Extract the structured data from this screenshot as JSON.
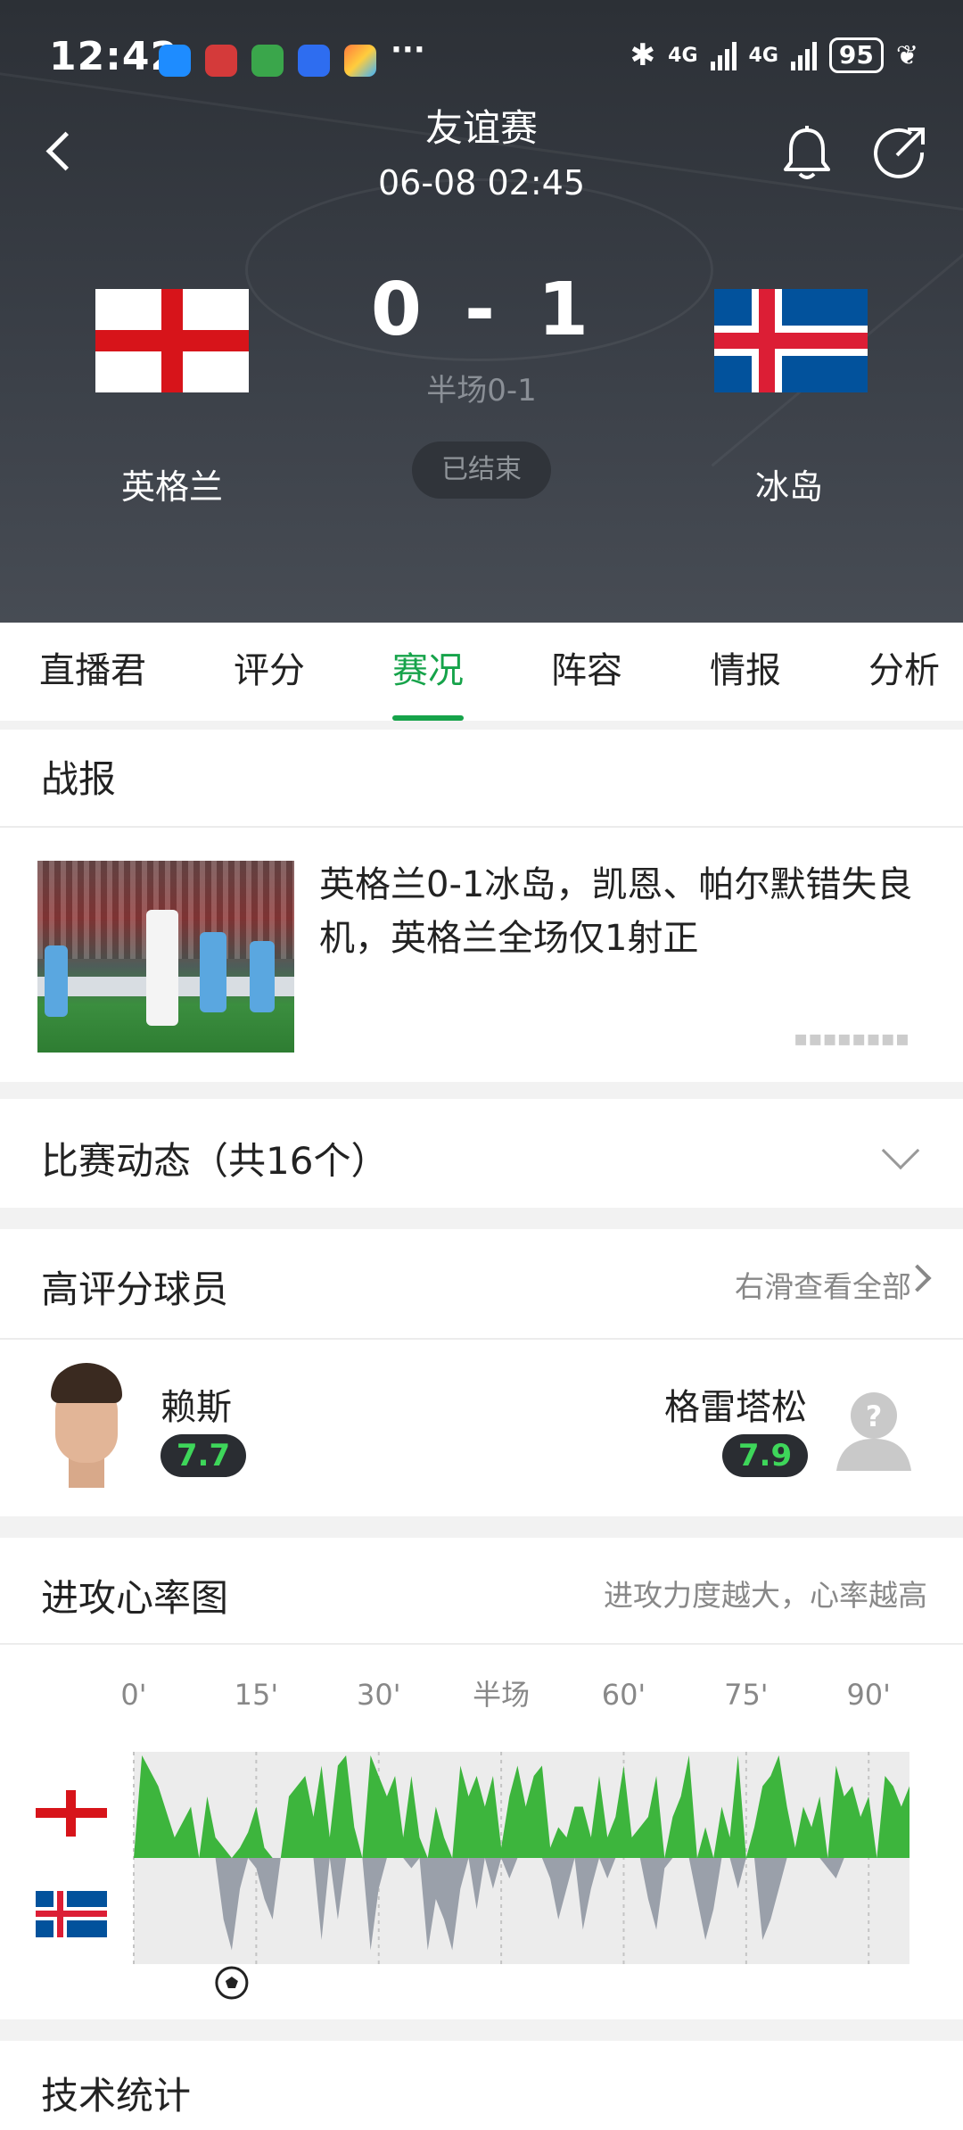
{
  "status_bar": {
    "time": "12:42",
    "more": "···",
    "signal1": "4G",
    "signal2": "4G",
    "battery": "95"
  },
  "header": {
    "competition": "友谊赛",
    "datetime": "06-08 02:45",
    "home": {
      "name": "英格兰",
      "score": "0"
    },
    "away": {
      "name": "冰岛",
      "score": "1"
    },
    "score_separator": "-",
    "halftime": "半场0-1",
    "status": "已结束"
  },
  "tabs": [
    {
      "label": "直播君"
    },
    {
      "label": "评分"
    },
    {
      "label": "赛况",
      "active": true
    },
    {
      "label": "阵容"
    },
    {
      "label": "情报"
    },
    {
      "label": "分析"
    }
  ],
  "report": {
    "title": "战报",
    "headline": "英格兰0-1冰岛，凯恩、帕尔默错失良机，英格兰全场仅1射正"
  },
  "events": {
    "title": "比赛动态（共16个）"
  },
  "top_players": {
    "title": "高评分球员",
    "link": "右滑查看全部",
    "home": {
      "name": "赖斯",
      "rating": "7.7"
    },
    "away": {
      "name": "格雷塔松",
      "rating": "7.9"
    }
  },
  "momentum": {
    "title": "进攻心率图",
    "note": "进攻力度越大，心率越高",
    "ticks": [
      "0'",
      "15'",
      "30'",
      "半场",
      "60'",
      "75'",
      "90'"
    ]
  },
  "chart_data": {
    "type": "area",
    "title": "进攻心率图",
    "x_ticks": [
      "0'",
      "15'",
      "30'",
      "半场",
      "60'",
      "75'",
      "90'"
    ],
    "xlim": [
      0,
      95
    ],
    "ylim": [
      -1,
      1
    ],
    "series": [
      {
        "team": "England",
        "color": "#3db53d",
        "x": [
          0,
          1,
          3,
          5,
          7,
          8,
          9,
          10,
          12,
          13,
          14,
          15,
          16,
          17,
          18,
          19,
          21,
          22,
          23,
          24,
          25,
          26,
          27,
          28,
          29,
          30,
          31,
          32,
          33,
          34,
          35,
          36,
          37,
          38,
          39,
          40,
          41,
          42,
          43,
          44,
          45,
          46,
          47,
          48,
          49,
          50,
          51,
          52,
          53,
          54,
          55,
          56,
          57,
          58,
          59,
          60,
          61,
          62,
          63,
          64,
          65,
          66,
          67,
          68,
          69,
          70,
          71,
          72,
          73,
          74,
          75,
          76,
          77,
          78,
          79,
          80,
          81,
          82,
          83,
          84,
          85,
          86,
          87,
          88,
          89,
          90,
          91,
          92,
          93,
          94,
          95
        ],
        "values": [
          0,
          1.0,
          0.7,
          0.2,
          0.5,
          0,
          0.6,
          0.2,
          0,
          0.1,
          0.25,
          0.5,
          0.1,
          0,
          0,
          0.6,
          0.8,
          0.4,
          0.9,
          0.2,
          0.9,
          1.0,
          0.3,
          0,
          1.0,
          0.8,
          0.6,
          0.8,
          0.2,
          0.8,
          0.2,
          0,
          0.5,
          0.2,
          0,
          0.9,
          0.6,
          0.8,
          0.5,
          0.8,
          0.1,
          0.6,
          0.9,
          0.5,
          0.8,
          0.9,
          0.1,
          0.3,
          0.2,
          0.5,
          0.5,
          0.2,
          0.8,
          0.2,
          0.4,
          0.9,
          0.2,
          0.3,
          0.4,
          0.8,
          0,
          0.4,
          0.6,
          1.0,
          0,
          0.3,
          0,
          0.5,
          0.2,
          1.0,
          0,
          0.3,
          0.7,
          0.8,
          1.0,
          0.5,
          0.1,
          0.5,
          0.3,
          0.6,
          0,
          0.9,
          0.6,
          0.7,
          0.4,
          0.6,
          0,
          0.8,
          0.7,
          0.5,
          0.7
        ]
      },
      {
        "team": "Iceland",
        "color": "#9aa0aa",
        "x": [
          0,
          2,
          4,
          6,
          8,
          10,
          11,
          12,
          13,
          14,
          15,
          16,
          17,
          18,
          19,
          20,
          21,
          22,
          23,
          24,
          25,
          26,
          27,
          28,
          29,
          30,
          31,
          32,
          33,
          34,
          35,
          36,
          37,
          38,
          39,
          40,
          41,
          42,
          43,
          44,
          45,
          46,
          47,
          48,
          49,
          50,
          51,
          52,
          53,
          54,
          55,
          56,
          57,
          58,
          59,
          60,
          61,
          62,
          63,
          64,
          65,
          66,
          67,
          68,
          69,
          70,
          71,
          72,
          73,
          74,
          75,
          76,
          77,
          78,
          79,
          80,
          81,
          82,
          83,
          84,
          85,
          86,
          87,
          88,
          89,
          90,
          91,
          92,
          93,
          94,
          95
        ],
        "values": [
          0,
          0,
          0,
          0,
          0,
          0,
          -0.6,
          -0.9,
          -0.3,
          0,
          -0.1,
          -0.4,
          -0.6,
          0,
          0,
          0,
          0,
          0,
          -0.8,
          0,
          -0.6,
          0,
          0,
          0,
          -0.9,
          -0.3,
          0,
          0,
          0,
          -0.1,
          0,
          -0.9,
          -0.4,
          -0.6,
          -0.9,
          -0.3,
          0,
          -0.5,
          0,
          -0.3,
          0,
          -0.2,
          0,
          0,
          0,
          0,
          -0.2,
          -0.6,
          -0.3,
          0,
          -0.7,
          -0.3,
          0,
          -0.2,
          0,
          0,
          0,
          0,
          -0.4,
          -0.7,
          -0.1,
          0,
          0,
          0,
          -0.4,
          -0.8,
          -0.5,
          0,
          0,
          -0.3,
          0,
          0,
          -0.8,
          -0.6,
          -0.3,
          0,
          0,
          0,
          0,
          0,
          -0.1,
          -0.2,
          0,
          0,
          0,
          0,
          0,
          0,
          0,
          0,
          0
        ]
      }
    ],
    "events": [
      {
        "type": "goal",
        "minute": 12,
        "team": "Iceland"
      }
    ]
  },
  "stats": {
    "title": "技术统计"
  },
  "colors": {
    "accent": "#16a34a",
    "home_area": "#3db53d",
    "away_area": "#9aa0aa",
    "rating": "#3ed65a"
  }
}
